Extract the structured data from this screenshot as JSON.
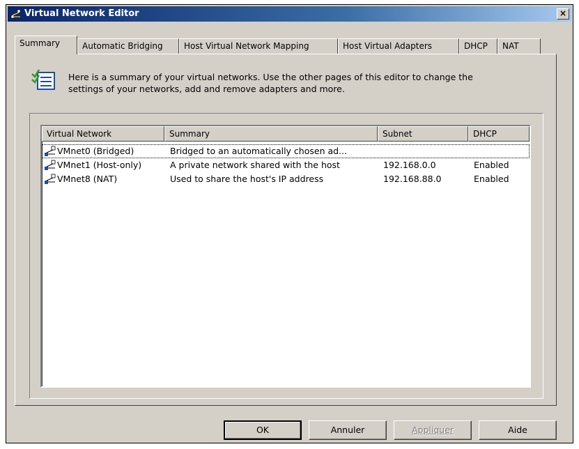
{
  "window": {
    "title": "Virtual Network Editor",
    "close_label": "×"
  },
  "tabs": [
    {
      "label": "Summary"
    },
    {
      "label": "Automatic Bridging"
    },
    {
      "label": "Host Virtual Network Mapping"
    },
    {
      "label": "Host Virtual Adapters"
    },
    {
      "label": "DHCP"
    },
    {
      "label": "NAT"
    }
  ],
  "intro": {
    "line1": "Here is a summary of your virtual networks. Use the other pages of this editor to change the",
    "line2": "settings of your networks, add and remove adapters and more."
  },
  "table": {
    "columns": [
      "Virtual Network",
      "Summary",
      "Subnet",
      "DHCP"
    ],
    "rows": [
      {
        "network": "VMnet0 (Bridged)",
        "summary": "Bridged to an automatically chosen ad...",
        "subnet": "",
        "dhcp": ""
      },
      {
        "network": "VMnet1 (Host-only)",
        "summary": "A private network shared with the host",
        "subnet": "192.168.0.0",
        "dhcp": "Enabled"
      },
      {
        "network": "VMnet8 (NAT)",
        "summary": "Used to share the host's IP address",
        "subnet": "192.168.88.0",
        "dhcp": "Enabled"
      }
    ]
  },
  "buttons": {
    "ok": "OK",
    "cancel": "Annuler",
    "apply": "Appliquer",
    "help": "Aide"
  },
  "icons": {
    "window": "network-icon",
    "summary": "checklist-icon",
    "row": "network-adapter-icon"
  },
  "colors": {
    "titlebar_start": "#0a246a",
    "titlebar_end": "#a6caf0",
    "face": "#d4d0c8"
  }
}
